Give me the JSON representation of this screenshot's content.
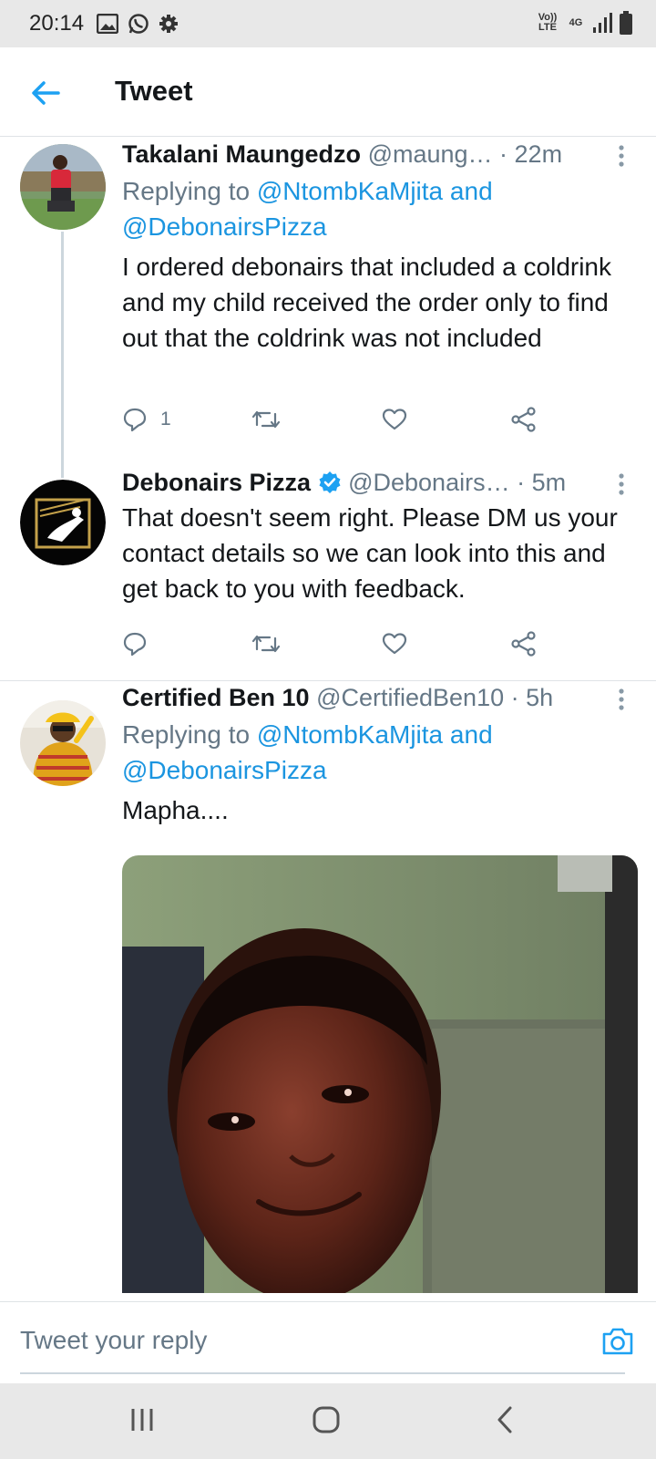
{
  "status_bar": {
    "time": "20:14",
    "left_icons": [
      "image-icon",
      "whatsapp-icon",
      "gear-icon"
    ],
    "volte": "Vo)) LTE",
    "network": "4G"
  },
  "header": {
    "title": "Tweet"
  },
  "tweets": [
    {
      "name": "Takalani Maungedzo",
      "handle": "@maung…",
      "time": "· 22m",
      "replying_prefix": "Replying to ",
      "mention1": "@NtombKaMjita",
      "and": " and",
      "mention2": "@DebonairsPizza",
      "text": "I ordered debonairs that included a coldrink and my child received the order only to find out that the coldrink was not included",
      "reply_count": "1"
    },
    {
      "name": "Debonairs Pizza",
      "verified": true,
      "handle": "@Debonairs…",
      "time": "· 5m",
      "text": "That doesn't seem right. Please DM us your contact details so we can look into this and get back to you with feedback.",
      "reply_count": ""
    },
    {
      "name": "Certified Ben 10",
      "handle": "@CertifiedBen10",
      "time": "· 5h",
      "replying_prefix": "Replying to ",
      "mention1": "@NtombKaMjita",
      "and": " and",
      "mention2": "@DebonairsPizza",
      "text": "Mapha...."
    }
  ],
  "reply_box": {
    "placeholder": "Tweet your reply"
  },
  "colors": {
    "accent": "#1da1f2",
    "mention": "#1b95e0",
    "secondary_text": "#657786",
    "divider": "#dfe3e6"
  }
}
